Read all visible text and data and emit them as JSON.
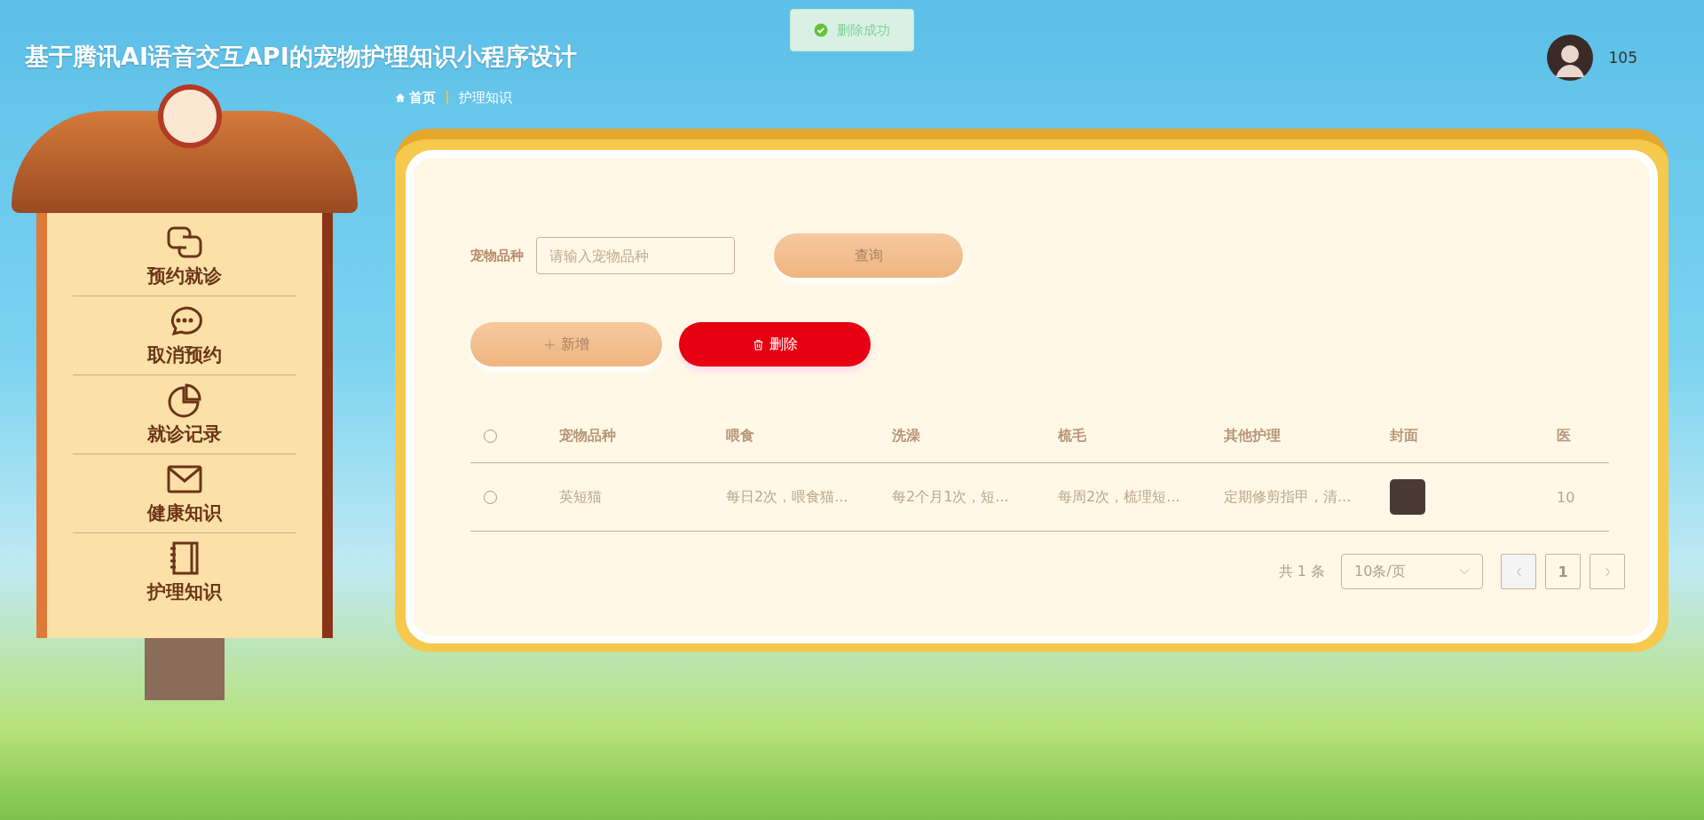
{
  "header": {
    "title": "基于腾讯AI语音交互API的宠物护理知识小程序设计",
    "user": "105"
  },
  "toast": {
    "message": "删除成功"
  },
  "breadcrumb": [
    {
      "label": "首页",
      "kind": "home"
    },
    {
      "label": "护理知识",
      "kind": "page"
    }
  ],
  "sidebar": {
    "items": [
      {
        "label": "预约就诊",
        "selected": false
      },
      {
        "label": "取消预约",
        "selected": false
      },
      {
        "label": "就诊记录",
        "selected": false
      },
      {
        "label": "健康知识",
        "selected": false
      },
      {
        "label": "护理知识",
        "selected": false
      }
    ]
  },
  "search": {
    "label": "宠物品种",
    "placeholder": "请输入宠物品种",
    "button": "查询"
  },
  "actions": [
    {
      "label": "新增",
      "kind": "add"
    },
    {
      "label": "删除",
      "kind": "delete"
    }
  ],
  "table": {
    "select_all_checked": false,
    "columns": [
      "宠物品种",
      "喂食",
      "洗澡",
      "梳毛",
      "其他护理",
      "封面",
      "医"
    ],
    "rows": [
      {
        "checked": false,
        "cells": [
          "英短猫",
          "每日2次，喂食猫...",
          "每2个月1次，短...",
          "每周2次，梳理短...",
          "定期修剪指甲，清...",
          null,
          "10"
        ]
      }
    ]
  },
  "pagination": {
    "total": "共 1 条",
    "page_size": "10条/页",
    "pages": [
      {
        "label": "1",
        "selected": true
      }
    ]
  }
}
